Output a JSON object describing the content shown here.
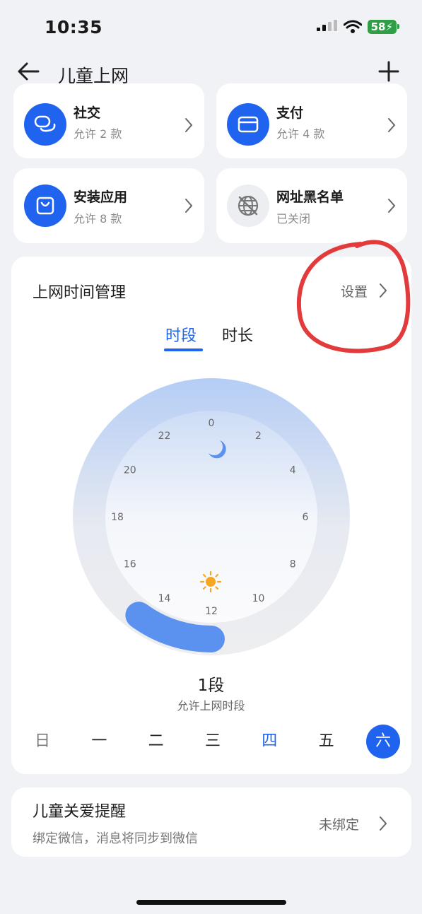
{
  "status_bar": {
    "time": "10:35",
    "battery": "58"
  },
  "header": {
    "title": "儿童上网"
  },
  "apps": [
    {
      "name": "社交",
      "sub": "允许 2 款",
      "icon": "chat-icon"
    },
    {
      "name": "支付",
      "sub": "允许 4 款",
      "icon": "card-icon"
    },
    {
      "name": "安装应用",
      "sub": "允许 8 款",
      "icon": "shopping-bag-icon"
    },
    {
      "name": "网址黑名单",
      "sub": "已关闭",
      "icon": "globe-blocked-icon"
    }
  ],
  "time_management": {
    "title": "上网时间管理",
    "settings_label": "设置",
    "tabs": [
      "时段",
      "时长"
    ],
    "active_tab": 0,
    "clock_labels": [
      "0",
      "2",
      "4",
      "6",
      "8",
      "10",
      "12",
      "14",
      "16",
      "18",
      "20",
      "22"
    ],
    "segment_count": "1段",
    "segment_desc": "允许上网时段",
    "weekdays": [
      "日",
      "一",
      "二",
      "三",
      "四",
      "五",
      "六"
    ],
    "today_index": 4,
    "selected_index": 6
  },
  "care": {
    "title": "儿童关爱提醒",
    "subtitle": "绑定微信，消息将同步到微信",
    "status": "未绑定"
  },
  "colors": {
    "accent": "#1f63ee",
    "battery": "#2f9e44",
    "annotation": "#e23b3b"
  }
}
